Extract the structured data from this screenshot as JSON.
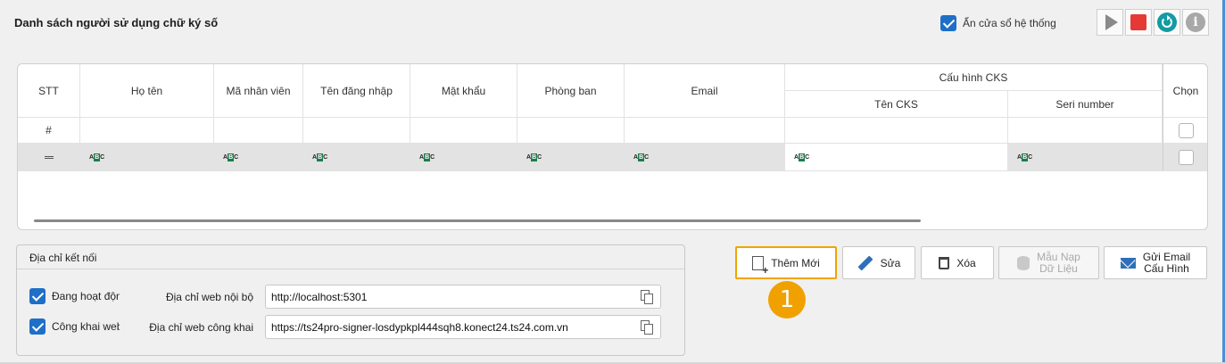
{
  "header": {
    "title": "Danh sách người sử dụng chữ ký số",
    "hide_system_window_label": "Ẩn cửa sổ hệ thống",
    "hide_system_window_checked": true
  },
  "toolbar_icons": [
    "play-icon",
    "stop-icon",
    "refresh-icon",
    "info-icon"
  ],
  "colors": {
    "accent_blue": "#1e6fc7",
    "highlight_orange": "#f0a500",
    "stop_red": "#e53935",
    "refresh_teal": "#139aa3"
  },
  "grid": {
    "group_header": "Cấu hình CKS",
    "columns": {
      "stt": "STT",
      "ho_ten": "Họ tên",
      "ma_nv": "Mã nhân viên",
      "ten_dang_nhap": "Tên đăng nhập",
      "mat_khau": "Mật khẩu",
      "phong_ban": "Phòng ban",
      "email": "Email",
      "ten_cks": "Tên CKS",
      "seri": "Seri number",
      "chon": "Chọn"
    },
    "filter_row_symbol": "#",
    "abc_icon": {
      "a": "A",
      "b": "B",
      "c": "C"
    }
  },
  "connection": {
    "title": "Địa chỉ kết nối",
    "active_label": "Đang hoạt động",
    "active_checked": true,
    "public_label": "Công khai web",
    "public_checked": true,
    "local_web_label": "Địa chỉ web nội bộ",
    "local_web_value": "http://localhost:5301",
    "public_web_label": "Địa chỉ web công khai",
    "public_web_value": "https://ts24pro-signer-losdypkpl444sqh8.konect24.ts24.com.vn"
  },
  "actions": {
    "add_label": "Thêm Mới",
    "edit_label": "Sửa",
    "delete_label": "Xóa",
    "template_line1": "Mẫu Nạp",
    "template_line2": "Dữ Liệu",
    "send_email_line1": "Gửi Email",
    "send_email_line2": "Cấu Hình"
  },
  "step_badge": "1"
}
